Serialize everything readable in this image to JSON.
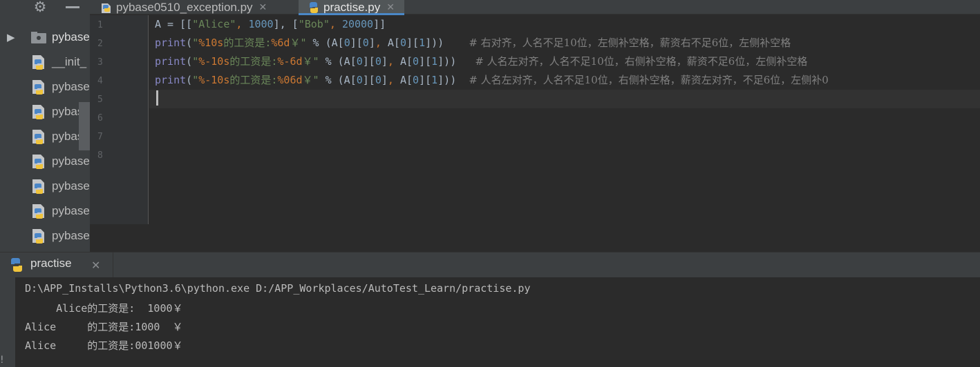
{
  "sidebar": {
    "toolbar": {
      "gear_icon": "gear-icon",
      "minimize_icon": "minimize-icon"
    },
    "tree": [
      {
        "label": "pybase",
        "icon": "folder-icon",
        "expand": "▶"
      },
      {
        "label": "__init_",
        "icon": "python-file-icon"
      },
      {
        "label": "pybase",
        "icon": "python-file-icon"
      },
      {
        "label": "pybase",
        "icon": "python-file-icon"
      },
      {
        "label": "pybase",
        "icon": "python-file-icon"
      },
      {
        "label": "pybase",
        "icon": "python-file-icon"
      },
      {
        "label": "pybase",
        "icon": "python-file-icon"
      },
      {
        "label": "pybase",
        "icon": "python-file-icon"
      },
      {
        "label": "pybase",
        "icon": "python-file-icon"
      }
    ]
  },
  "editor": {
    "tabs": [
      {
        "label": "pybase0510_exception.py",
        "close": "✕",
        "active": false
      },
      {
        "label": "practise.py",
        "close": "✕",
        "active": true
      }
    ],
    "line_numbers": [
      "1",
      "2",
      "3",
      "4",
      "5",
      "6",
      "7",
      "8"
    ],
    "code_lines": [
      [
        {
          "t": "A = [[",
          "c": "k-id"
        },
        {
          "t": "\"Alice\"",
          "c": "k-str"
        },
        {
          "t": ", ",
          "c": "k-fmt"
        },
        {
          "t": "1000",
          "c": "k-num"
        },
        {
          "t": "], [",
          "c": "k-id"
        },
        {
          "t": "\"Bob\"",
          "c": "k-str"
        },
        {
          "t": ", ",
          "c": "k-fmt"
        },
        {
          "t": "20000",
          "c": "k-num"
        },
        {
          "t": "]]",
          "c": "k-id"
        }
      ],
      [
        {
          "t": "print",
          "c": "k-bi"
        },
        {
          "t": "(",
          "c": "k-id"
        },
        {
          "t": "\"",
          "c": "k-str"
        },
        {
          "t": "%10s",
          "c": "k-fmt"
        },
        {
          "t": "的工资是:",
          "c": "k-str"
        },
        {
          "t": "%6d",
          "c": "k-fmt"
        },
        {
          "t": "￥\"",
          "c": "k-str"
        },
        {
          "t": " % (A[",
          "c": "k-id"
        },
        {
          "t": "0",
          "c": "k-num"
        },
        {
          "t": "][",
          "c": "k-id"
        },
        {
          "t": "0",
          "c": "k-num"
        },
        {
          "t": "]",
          "c": "k-id"
        },
        {
          "t": ", ",
          "c": "k-fmt"
        },
        {
          "t": "A[",
          "c": "k-id"
        },
        {
          "t": "0",
          "c": "k-num"
        },
        {
          "t": "][",
          "c": "k-id"
        },
        {
          "t": "1",
          "c": "k-num"
        },
        {
          "t": "]))    ",
          "c": "k-id"
        },
        {
          "t": "# 右对齐，人名不足10位，左侧补空格，薪资右不足6位，左侧补空格",
          "c": "k-com"
        }
      ],
      [
        {
          "t": "print",
          "c": "k-bi"
        },
        {
          "t": "(",
          "c": "k-id"
        },
        {
          "t": "\"",
          "c": "k-str"
        },
        {
          "t": "%-10s",
          "c": "k-fmt"
        },
        {
          "t": "的工资是:",
          "c": "k-str"
        },
        {
          "t": "%-6d",
          "c": "k-fmt"
        },
        {
          "t": "￥\"",
          "c": "k-str"
        },
        {
          "t": " % (A[",
          "c": "k-id"
        },
        {
          "t": "0",
          "c": "k-num"
        },
        {
          "t": "][",
          "c": "k-id"
        },
        {
          "t": "0",
          "c": "k-num"
        },
        {
          "t": "]",
          "c": "k-id"
        },
        {
          "t": ", ",
          "c": "k-fmt"
        },
        {
          "t": "A[",
          "c": "k-id"
        },
        {
          "t": "0",
          "c": "k-num"
        },
        {
          "t": "][",
          "c": "k-id"
        },
        {
          "t": "1",
          "c": "k-num"
        },
        {
          "t": "]))   ",
          "c": "k-id"
        },
        {
          "t": "# 人名左对齐，人名不足10位，右侧补空格，薪资不足6位，左侧补空格",
          "c": "k-com"
        }
      ],
      [
        {
          "t": "print",
          "c": "k-bi"
        },
        {
          "t": "(",
          "c": "k-id"
        },
        {
          "t": "\"",
          "c": "k-str"
        },
        {
          "t": "%-10s",
          "c": "k-fmt"
        },
        {
          "t": "的工资是:",
          "c": "k-str"
        },
        {
          "t": "%06d",
          "c": "k-fmt"
        },
        {
          "t": "￥\"",
          "c": "k-str"
        },
        {
          "t": " % (A[",
          "c": "k-id"
        },
        {
          "t": "0",
          "c": "k-num"
        },
        {
          "t": "][",
          "c": "k-id"
        },
        {
          "t": "0",
          "c": "k-num"
        },
        {
          "t": "]",
          "c": "k-id"
        },
        {
          "t": ", ",
          "c": "k-fmt"
        },
        {
          "t": "A[",
          "c": "k-id"
        },
        {
          "t": "0",
          "c": "k-num"
        },
        {
          "t": "][",
          "c": "k-id"
        },
        {
          "t": "1",
          "c": "k-num"
        },
        {
          "t": "]))  ",
          "c": "k-id"
        },
        {
          "t": "# 人名左对齐，人名不足10位，右侧补空格，薪资左对齐，不足6位，左侧补0",
          "c": "k-com"
        }
      ],
      [],
      [],
      [],
      []
    ]
  },
  "run": {
    "tab_label": "practise",
    "tab_close": "✕",
    "partial_char": "!",
    "console_lines": [
      "D:\\APP_Installs\\Python3.6\\python.exe D:/APP_Workplaces/AutoTest_Learn/practise.py",
      "     Alice的工资是:  1000￥",
      "Alice     的工资是:1000  ￥",
      "Alice     的工资是:001000￥"
    ]
  },
  "colors": {
    "background": "#2b2b2b",
    "panel": "#3c3f41",
    "string": "#6a8759",
    "number": "#6897bb",
    "keyword": "#cc7832",
    "builtin": "#8888c6",
    "comment": "#808080",
    "tab_accent": "#4a88c7"
  }
}
